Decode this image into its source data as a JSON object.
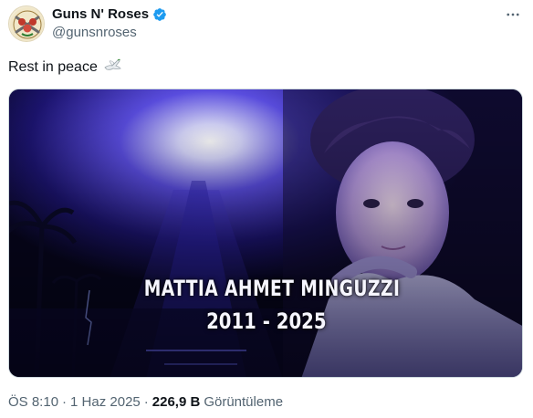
{
  "author": {
    "display_name": "Guns N' Roses",
    "handle": "@gunsnroses",
    "verified_icon": "verified-badge-icon",
    "avatar_icon": "guns-n-roses-logo",
    "accent_color": "#1d9bf0"
  },
  "menu": {
    "more_icon": "more-dots-icon"
  },
  "tweet": {
    "text": "Rest in peace",
    "emoji_icon": "dove-icon"
  },
  "media": {
    "name": "MATTIA AHMET MINGUZZI",
    "years": "2011 - 2025"
  },
  "footer": {
    "time": "ÖS 8:10",
    "separator": "·",
    "date": "1 Haz 2025",
    "separator2": "·",
    "views_count": "226,9 B",
    "views_label": "Görüntüleme"
  }
}
